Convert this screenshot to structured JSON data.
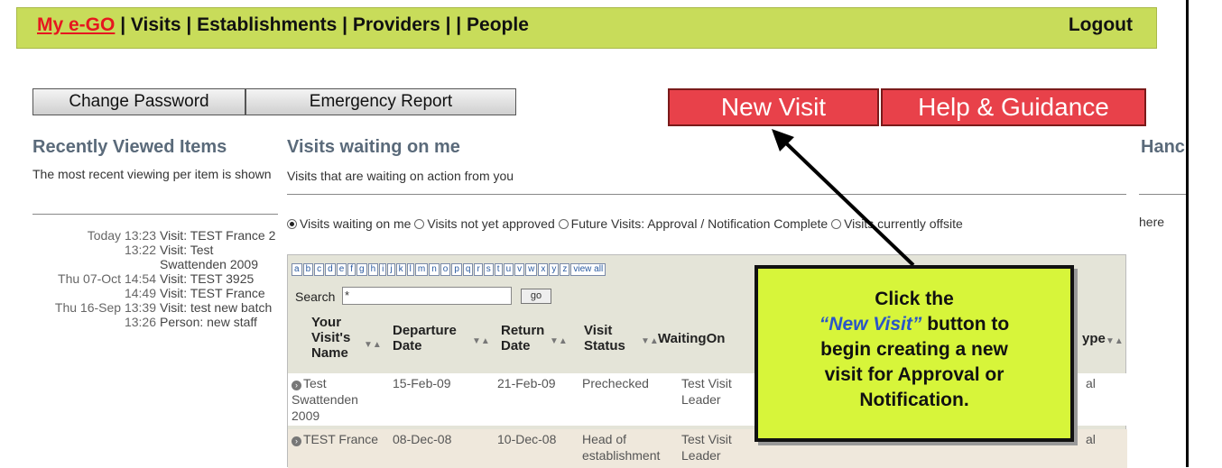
{
  "nav": {
    "my_ego": "My e-GO",
    "sep1": " | ",
    "visits": "Visits",
    "sep2": " | ",
    "establishments": "Establishments",
    "sep3": " | ",
    "providers": "Providers",
    "sep4": " | | ",
    "people": "People",
    "logout": "Logout"
  },
  "buttons": {
    "change_password": "Change Password",
    "emergency_report": "Emergency Report",
    "new_visit": "New Visit",
    "help_guidance": "Help & Guidance"
  },
  "recent": {
    "title": "Recently Viewed Items",
    "subtitle": "The most recent viewing per item is shown",
    "items": [
      {
        "time": "Today 13:23",
        "label": "Visit: TEST France 2"
      },
      {
        "time": "13:22",
        "label": "Visit: Test Swattenden 2009"
      },
      {
        "time": "Thu 07-Oct 14:54",
        "label": "Visit: TEST 3925"
      },
      {
        "time": "14:49",
        "label": "Visit: TEST France"
      },
      {
        "time": "Thu 16-Sep 13:39",
        "label": "Visit: test new batch"
      },
      {
        "time": "13:26",
        "label": "Person: new staff"
      }
    ]
  },
  "visits": {
    "title": "Visits waiting on me",
    "subtitle": "Visits that are waiting on action from you",
    "filters": [
      {
        "label": "Visits waiting on me",
        "selected": true
      },
      {
        "label": "Visits not yet approved",
        "selected": false
      },
      {
        "label": "Future Visits: Approval / Notification Complete",
        "selected": false
      },
      {
        "label": "Visits currently offsite",
        "selected": false
      }
    ],
    "letters": [
      "a",
      "b",
      "c",
      "d",
      "e",
      "f",
      "g",
      "h",
      "i",
      "j",
      "k",
      "l",
      "m",
      "n",
      "o",
      "p",
      "q",
      "r",
      "s",
      "t",
      "u",
      "v",
      "w",
      "x",
      "y",
      "z",
      "view all"
    ],
    "search_label": "Search",
    "search_value": "*",
    "go_label": "go",
    "columns": {
      "name": "Your Visit's Name",
      "departure": "Departure Date",
      "return": "Return Date",
      "status": "Visit Status",
      "waiting": "WaitingOn",
      "type": "ype"
    },
    "rows": [
      {
        "name": "Test Swattenden 2009",
        "departure": "15-Feb-09",
        "return": "21-Feb-09",
        "status": "Prechecked",
        "waiting": "Test Visit Leader",
        "type": "al"
      },
      {
        "name": "TEST France",
        "departure": "08-Dec-08",
        "return": "10-Dec-08",
        "status": "Head of establishment",
        "waiting": "Test Visit Leader",
        "type": "al"
      }
    ]
  },
  "right": {
    "title": "Hanc",
    "text": "here"
  },
  "callout": {
    "line1": "Click the",
    "emph": "“New Visit”",
    "line2": " button to",
    "line3": "begin creating a new",
    "line4": "visit for Approval or",
    "line5": "Notification."
  },
  "colors": {
    "nav_bg": "#c8dc5a",
    "red_button": "#e8414a",
    "callout_bg": "#d7f53a",
    "heading": "#5a6a7a"
  }
}
